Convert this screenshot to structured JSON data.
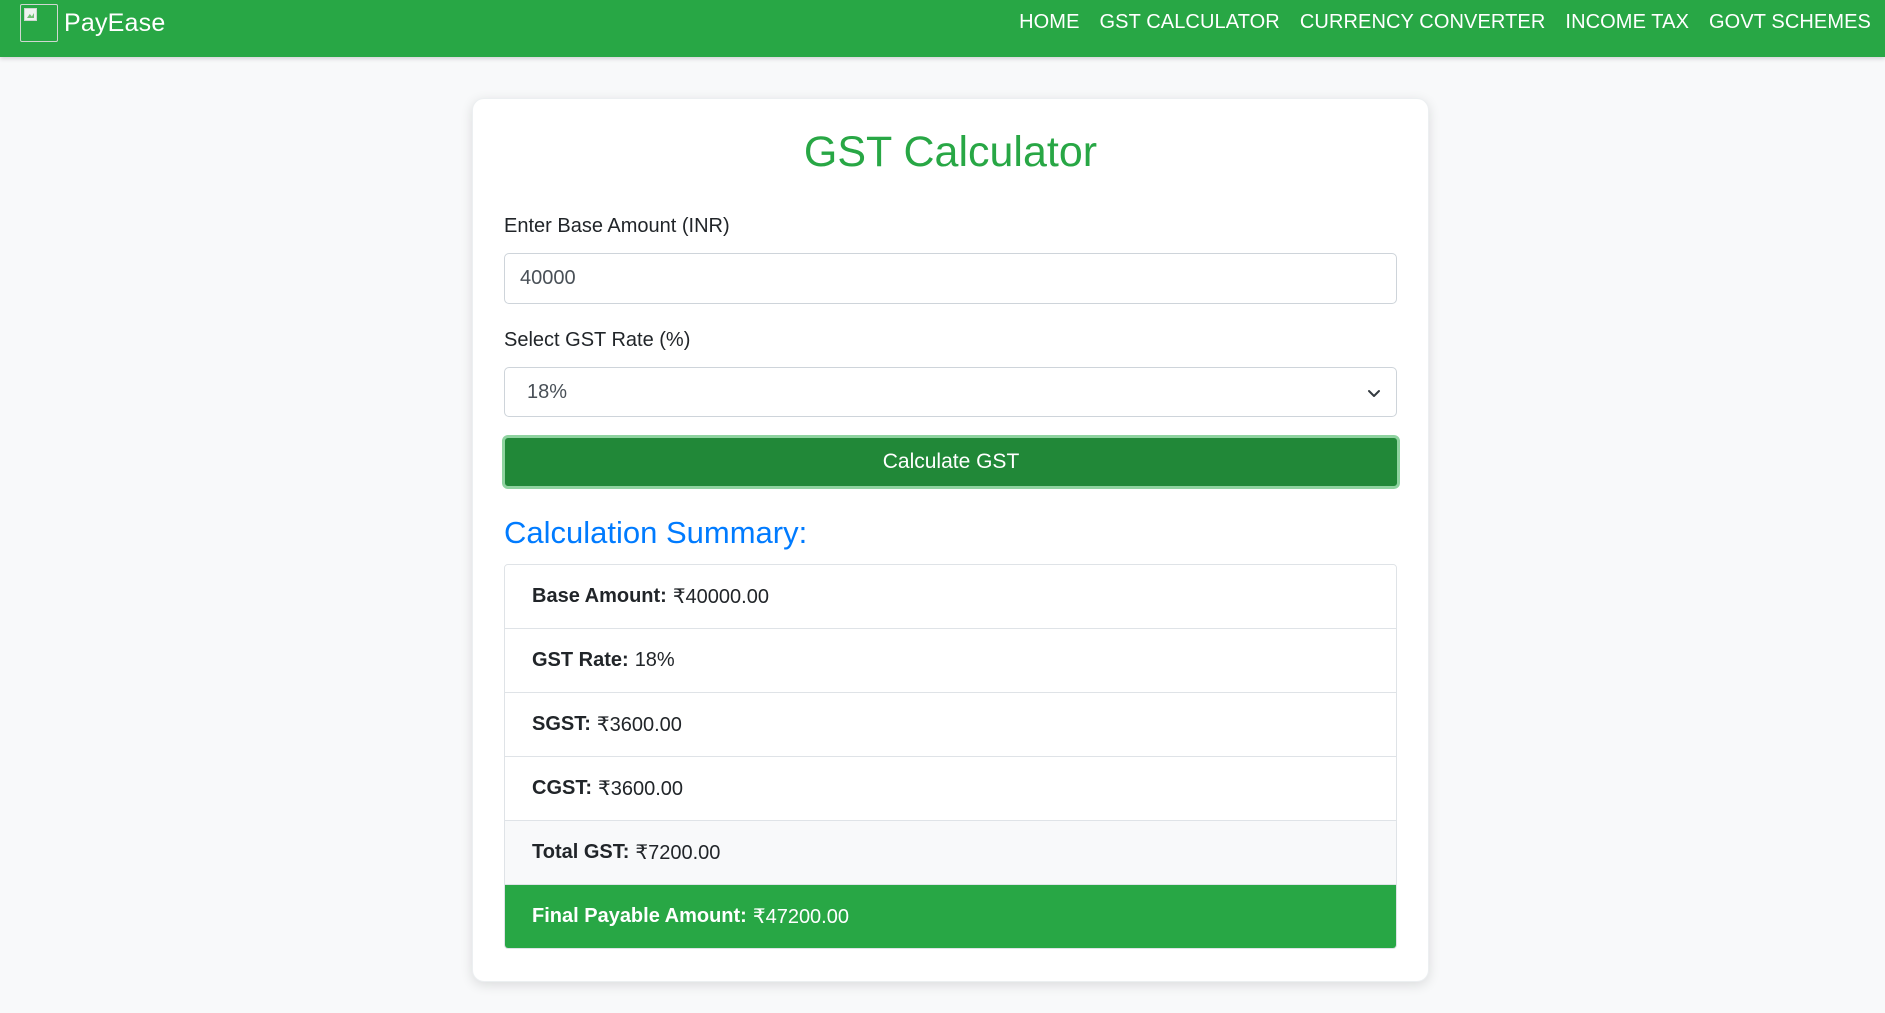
{
  "navbar": {
    "brand": "PayEase",
    "logo_icon": "broken-image-icon",
    "links": [
      "HOME",
      "GST CALCULATOR",
      "CURRENCY CONVERTER",
      "INCOME TAX",
      "GOVT SCHEMES"
    ]
  },
  "form": {
    "title": "GST Calculator",
    "amount_label": "Enter Base Amount (INR)",
    "amount_value": "40000",
    "rate_label": "Select GST Rate (%)",
    "rate_selected": "18%",
    "button_label": "Calculate GST"
  },
  "summary": {
    "title": "Calculation Summary:",
    "rows": [
      {
        "label": "Base Amount:",
        "value": "₹40000.00"
      },
      {
        "label": "GST Rate:",
        "value": "18%"
      },
      {
        "label": "SGST:",
        "value": "₹3600.00"
      },
      {
        "label": "CGST:",
        "value": "₹3600.00"
      },
      {
        "label": "Total GST:",
        "value": "₹7200.00"
      },
      {
        "label": "Final Payable Amount:",
        "value": "₹47200.00"
      }
    ]
  },
  "colors": {
    "brand_green": "#28a745",
    "button_green": "#218838",
    "summary_blue": "#007bff"
  }
}
